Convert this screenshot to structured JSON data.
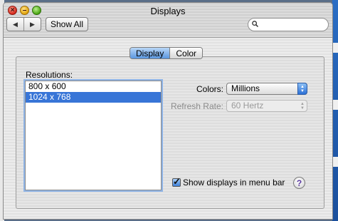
{
  "window": {
    "title": "Displays"
  },
  "toolbar": {
    "back_glyph": "◀",
    "forward_glyph": "▶",
    "show_all_label": "Show All",
    "search_value": "",
    "search_icon": "magnifier-icon"
  },
  "tabs": [
    {
      "label": "Display",
      "active": true
    },
    {
      "label": "Color",
      "active": false
    }
  ],
  "resolutions": {
    "label": "Resolutions:",
    "items": [
      {
        "label": "800 x 600",
        "selected": false
      },
      {
        "label": "1024 x 768",
        "selected": true
      }
    ]
  },
  "colors": {
    "label": "Colors:",
    "value": "Millions"
  },
  "refresh": {
    "label": "Refresh Rate:",
    "value": "60 Hertz",
    "enabled": false
  },
  "menu_bar_option": {
    "label": "Show displays in menu bar",
    "checked": true
  },
  "help": {
    "glyph": "?"
  },
  "accent_color": "#3875d7"
}
